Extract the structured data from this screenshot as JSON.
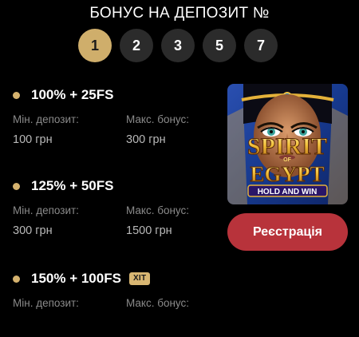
{
  "header": {
    "title": "БОНУС НА ДЕПОЗИТ №",
    "tabs": [
      "1",
      "2",
      "3",
      "5",
      "7"
    ],
    "active_tab": "1"
  },
  "offers": [
    {
      "title": "100% + 25FS",
      "min_label": "Мін. депозит:",
      "min_value": "100 грн",
      "max_label": "Макс. бонус:",
      "max_value": "300 грн"
    },
    {
      "title": "125% + 50FS",
      "min_label": "Мін. депозит:",
      "min_value": "300 грн",
      "max_label": "Макс. бонус:",
      "max_value": "1500 грн"
    },
    {
      "title": "150% + 100FS",
      "badge": "ХІТ",
      "min_label": "Мін. депозит:",
      "max_label": "Макс. бонус:"
    }
  ],
  "game": {
    "title_line1": "SPIRIT",
    "title_of": "OF",
    "title_line2": "EGYPT",
    "subtitle": "HOLD AND WIN"
  },
  "register": {
    "label": "Реєстрація"
  },
  "colors": {
    "background": "#000000",
    "gold": "#cfae6b",
    "tab_inactive": "#2b2b2b",
    "button_red": "#b8333b",
    "label_gray": "#8a8a8a"
  }
}
